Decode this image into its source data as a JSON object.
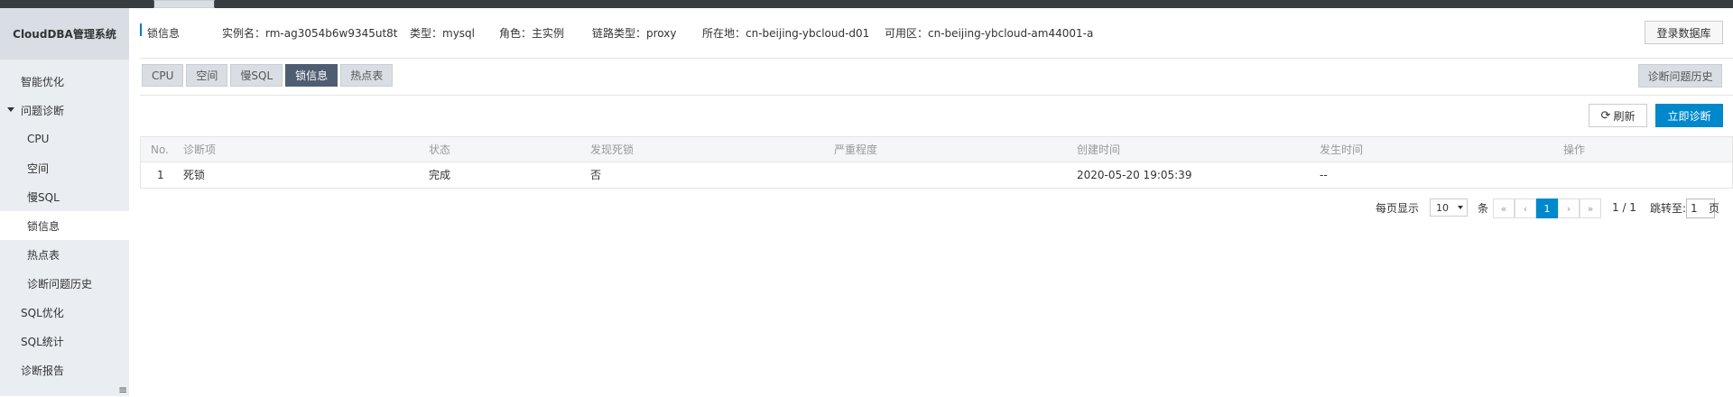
{
  "sidebar": {
    "title": "CloudDBA管理系统",
    "items": [
      {
        "label": "智能优化"
      },
      {
        "label": "问题诊断"
      },
      {
        "label": "CPU"
      },
      {
        "label": "空间"
      },
      {
        "label": "慢SQL"
      },
      {
        "label": "锁信息"
      },
      {
        "label": "热点表"
      },
      {
        "label": "诊断问题历史"
      },
      {
        "label": "SQL优化"
      },
      {
        "label": "SQL统计"
      },
      {
        "label": "诊断报告"
      }
    ],
    "collapse_icon": "≡"
  },
  "header": {
    "section_label": "锁信息",
    "instance": "实例名：rm-ag3054b6w9345ut8t",
    "type": "类型：mysql",
    "role": "角色：主实例",
    "link_type": "链路类型：proxy",
    "location": "所在地：cn-beijing-ybcloud-d01",
    "zone": "可用区：cn-beijing-ybcloud-am44001-a",
    "login_button": "登录数据库"
  },
  "tabs": [
    {
      "label": "CPU"
    },
    {
      "label": "空间"
    },
    {
      "label": "慢SQL"
    },
    {
      "label": "锁信息"
    },
    {
      "label": "热点表"
    }
  ],
  "history_button": "诊断问题历史",
  "refresh_button": "刷新",
  "refresh_icon": "⟳",
  "diagnose_button": "立即诊断",
  "table": {
    "headers": [
      "No.",
      "诊断项",
      "状态",
      "发现死锁",
      "严重程度",
      "创建时间",
      "发生时间",
      "操作"
    ],
    "rows": [
      [
        "1",
        "死锁",
        "完成",
        "否",
        "",
        "2020-05-20 19:05:39",
        "--",
        ""
      ]
    ]
  },
  "pagination": {
    "per_page_label": "每页显示",
    "per_page_value": "10",
    "unit": "条",
    "first": "«",
    "prev": "‹",
    "current": "1",
    "next": "›",
    "last": "»",
    "page_info": "1 / 1",
    "jump_label": "跳转至:",
    "jump_value": "1",
    "page_unit": "页"
  },
  "colors": {
    "primary": "#0088cc",
    "active_tab": "#4e5d71",
    "sidebar_bg": "#eaedf1",
    "topbar": "#373d41"
  }
}
